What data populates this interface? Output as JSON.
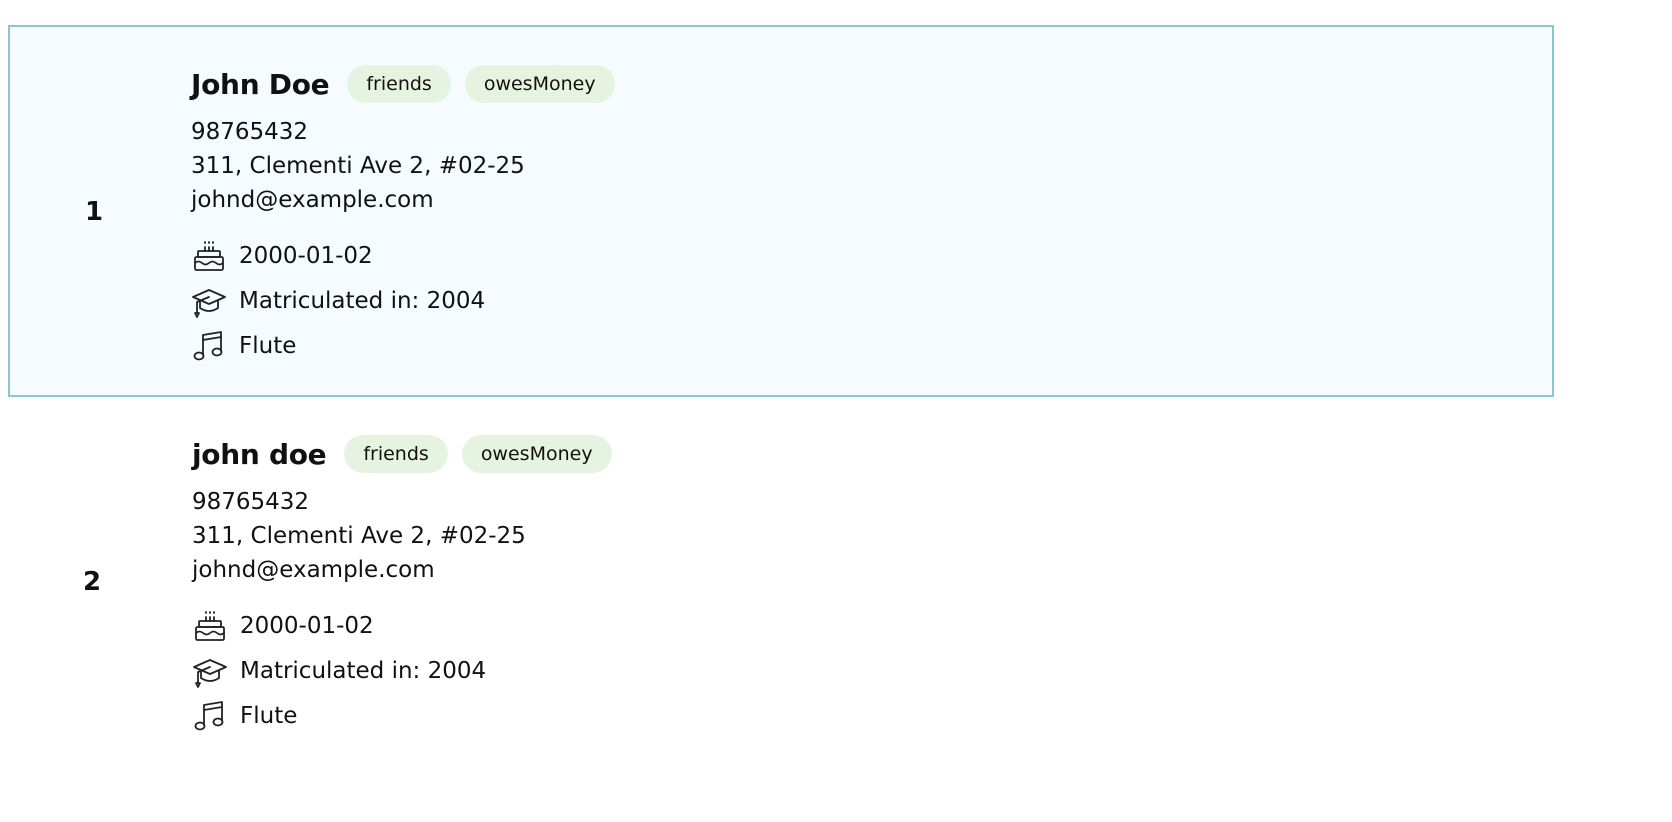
{
  "persons": [
    {
      "index": "1",
      "name": "John Doe",
      "tags": [
        "friends",
        "owesMoney"
      ],
      "phone": "98765432",
      "address": "311, Clementi Ave 2, #02-25",
      "email": "johnd@example.com",
      "birthday": "2000-01-02",
      "matriculation": "Matriculated in: 2004",
      "instrument": "Flute",
      "selected": true
    },
    {
      "index": "2",
      "name": "john doe",
      "tags": [
        "friends",
        "owesMoney"
      ],
      "phone": "98765432",
      "address": "311, Clementi Ave 2, #02-25",
      "email": "johnd@example.com",
      "birthday": "2000-01-02",
      "matriculation": "Matriculated in: 2004",
      "instrument": "Flute",
      "selected": false
    }
  ],
  "icons": {
    "birthday": "cake-icon",
    "matriculation": "graduation-cap-icon",
    "instrument": "music-note-icon"
  },
  "colors": {
    "selected_background": "#f5fbfe",
    "selected_border": "#8ec3d2",
    "tag_background": "#e6f3e1"
  }
}
